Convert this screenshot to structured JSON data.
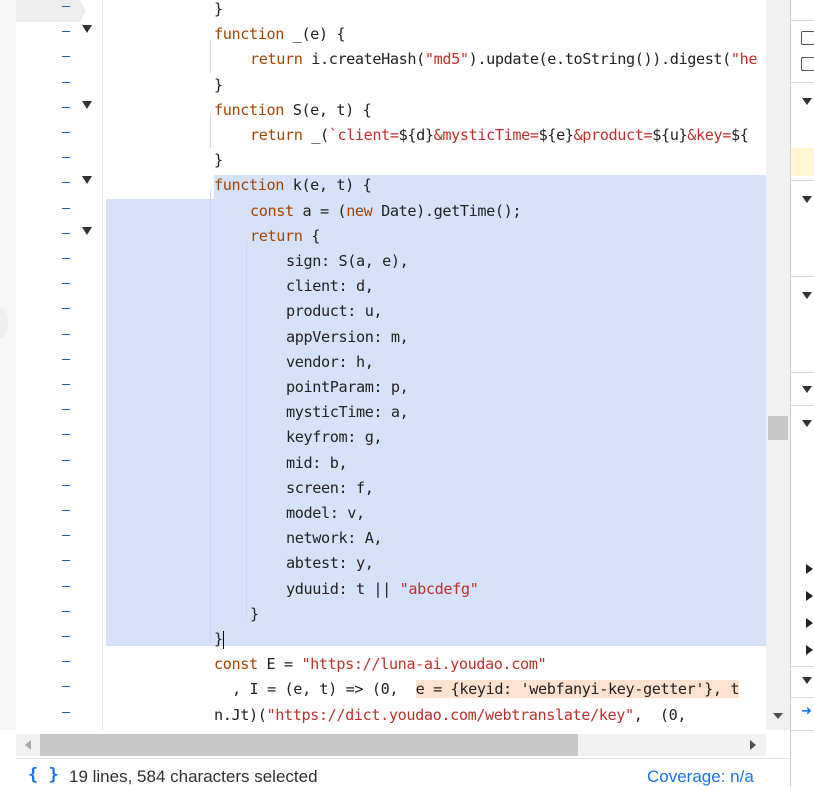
{
  "code_lines": [
    {
      "indent": 0,
      "fold": false,
      "html_tokens": [
        [
          "}",
          "p"
        ]
      ]
    },
    {
      "indent": 0,
      "fold": true,
      "html_tokens": [
        [
          "function",
          "kw"
        ],
        [
          " _(e) {",
          "p"
        ]
      ]
    },
    {
      "indent": 1,
      "fold": false,
      "html_tokens": [
        [
          "return",
          "kw"
        ],
        [
          " i.createHash(",
          "p"
        ],
        [
          "\"md5\"",
          "str"
        ],
        [
          ").update(e.toString()).digest(",
          "p"
        ],
        [
          "\"he",
          "str"
        ]
      ]
    },
    {
      "indent": 0,
      "fold": false,
      "html_tokens": [
        [
          "}",
          "p"
        ]
      ]
    },
    {
      "indent": 0,
      "fold": true,
      "html_tokens": [
        [
          "function",
          "kw"
        ],
        [
          " S(e, t) {",
          "p"
        ]
      ]
    },
    {
      "indent": 1,
      "fold": false,
      "html_tokens": [
        [
          "return",
          "kw"
        ],
        [
          " _(",
          "p"
        ],
        [
          "`client=",
          "str"
        ],
        [
          "${d}",
          "p"
        ],
        [
          "&mysticTime=",
          "str"
        ],
        [
          "${e}",
          "p"
        ],
        [
          "&product=",
          "str"
        ],
        [
          "${u}",
          "p"
        ],
        [
          "&key=",
          "str"
        ],
        [
          "${",
          "p"
        ]
      ]
    },
    {
      "indent": 0,
      "fold": false,
      "html_tokens": [
        [
          "}",
          "p"
        ]
      ]
    },
    {
      "indent": 0,
      "fold": true,
      "html_tokens": [
        [
          "function",
          "kw"
        ],
        [
          " k(e, t) {",
          "p"
        ]
      ]
    },
    {
      "indent": 1,
      "fold": false,
      "html_tokens": [
        [
          "const",
          "kw"
        ],
        [
          " a = (",
          "p"
        ],
        [
          "new",
          "kw"
        ],
        [
          " Date).getTime();",
          "p"
        ]
      ]
    },
    {
      "indent": 1,
      "fold": true,
      "html_tokens": [
        [
          "return",
          "kw"
        ],
        [
          " {",
          "p"
        ]
      ]
    },
    {
      "indent": 2,
      "fold": false,
      "html_tokens": [
        [
          "sign: S(a, e),",
          "p"
        ]
      ]
    },
    {
      "indent": 2,
      "fold": false,
      "html_tokens": [
        [
          "client: d,",
          "p"
        ]
      ]
    },
    {
      "indent": 2,
      "fold": false,
      "html_tokens": [
        [
          "product: u,",
          "p"
        ]
      ]
    },
    {
      "indent": 2,
      "fold": false,
      "html_tokens": [
        [
          "appVersion: m,",
          "p"
        ]
      ]
    },
    {
      "indent": 2,
      "fold": false,
      "html_tokens": [
        [
          "vendor: h,",
          "p"
        ]
      ]
    },
    {
      "indent": 2,
      "fold": false,
      "html_tokens": [
        [
          "pointParam: p,",
          "p"
        ]
      ]
    },
    {
      "indent": 2,
      "fold": false,
      "html_tokens": [
        [
          "mysticTime: a,",
          "p"
        ]
      ]
    },
    {
      "indent": 2,
      "fold": false,
      "html_tokens": [
        [
          "keyfrom: g,",
          "p"
        ]
      ]
    },
    {
      "indent": 2,
      "fold": false,
      "html_tokens": [
        [
          "mid: b,",
          "p"
        ]
      ]
    },
    {
      "indent": 2,
      "fold": false,
      "html_tokens": [
        [
          "screen: f,",
          "p"
        ]
      ]
    },
    {
      "indent": 2,
      "fold": false,
      "html_tokens": [
        [
          "model: v,",
          "p"
        ]
      ]
    },
    {
      "indent": 2,
      "fold": false,
      "html_tokens": [
        [
          "network: A,",
          "p"
        ]
      ]
    },
    {
      "indent": 2,
      "fold": false,
      "html_tokens": [
        [
          "abtest: y,",
          "p"
        ]
      ]
    },
    {
      "indent": 2,
      "fold": false,
      "html_tokens": [
        [
          "yduuid: t || ",
          "p"
        ],
        [
          "\"abcdefg\"",
          "str"
        ]
      ]
    },
    {
      "indent": 1,
      "fold": false,
      "html_tokens": [
        [
          "}",
          "p"
        ]
      ]
    },
    {
      "indent": 0,
      "fold": false,
      "cursor": true,
      "html_tokens": [
        [
          "}",
          "p"
        ]
      ]
    },
    {
      "indent": 0,
      "fold": false,
      "html_tokens": [
        [
          "const",
          "kw"
        ],
        [
          " E = ",
          "p"
        ],
        [
          "\"https://luna-ai.youdao.com\"",
          "str"
        ]
      ]
    },
    {
      "indent": 0,
      "fold": false,
      "extra_indent": true,
      "html_tokens": [
        [
          ", I = (e, t) => (0,  ",
          "p"
        ],
        [
          "e = {keyid: 'webfanyi-key-getter'}, t",
          "hl"
        ]
      ]
    },
    {
      "indent": -1,
      "fold": false,
      "html_tokens": [
        [
          "n.Jt)(",
          "p"
        ],
        [
          "\"https://dict.youdao.com/webtranslate/key\"",
          "str"
        ],
        [
          ",  (0,",
          "p"
        ]
      ]
    }
  ],
  "status": {
    "braces_icon": "{ }",
    "selection_text": "19 lines, 584 characters selected",
    "coverage_text": "Coverage: n/a"
  },
  "icons": {
    "fold": "chevron-down-icon",
    "scroll_left": "arrow-left-icon",
    "scroll_right": "arrow-right-icon",
    "scroll_down": "arrow-down-icon",
    "format": "pretty-print-icon"
  }
}
